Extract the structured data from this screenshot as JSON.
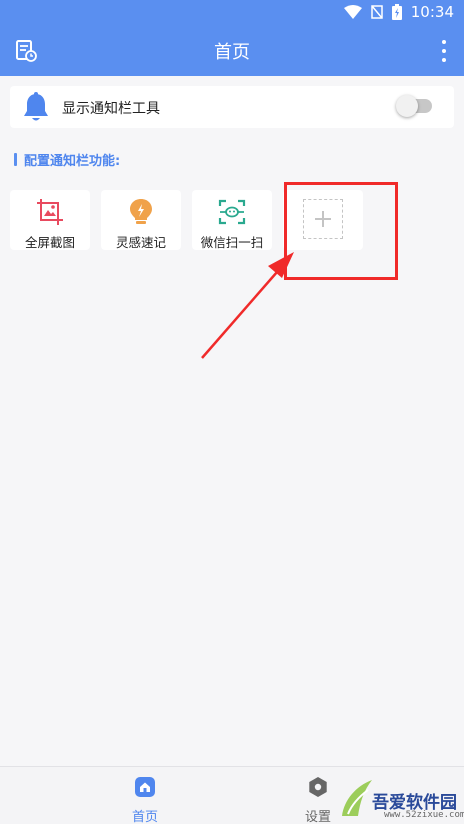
{
  "status_bar": {
    "time": "10:34"
  },
  "app_bar": {
    "title": "首页"
  },
  "notify_toggle": {
    "label": "显示通知栏工具",
    "enabled": false
  },
  "config_section": {
    "title": "配置通知栏功能:"
  },
  "tiles": [
    {
      "label": "全屏截图",
      "icon": "screenshot-icon",
      "color": "#e84a5f"
    },
    {
      "label": "灵感速记",
      "icon": "lightbulb-icon",
      "color": "#f0a24a"
    },
    {
      "label": "微信扫一扫",
      "icon": "wechat-scan-icon",
      "color": "#2aa98f"
    },
    {
      "label": "",
      "icon": "add-icon"
    }
  ],
  "bottom_nav": {
    "home_label": "首页",
    "settings_label": "设置",
    "active": "home"
  },
  "watermark": {
    "text": "吾爱软件园",
    "url": "www.52zixue.com"
  },
  "colors": {
    "primary": "#5a8ff0",
    "accent_text": "#4f86ee",
    "highlight": "#f02a2a"
  }
}
